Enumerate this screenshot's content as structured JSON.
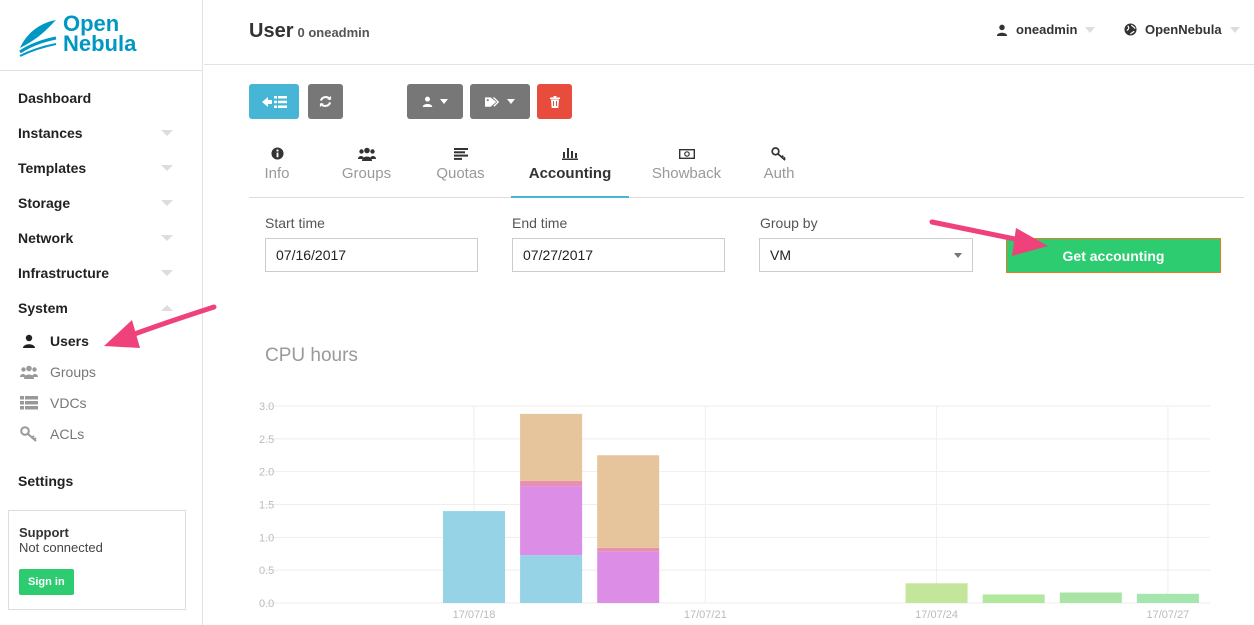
{
  "brand": {
    "logo_line1": "Open",
    "logo_line2": "Nebula"
  },
  "sidebar": {
    "items": [
      {
        "label": "Dashboard",
        "chevron": "none"
      },
      {
        "label": "Instances",
        "chevron": "down"
      },
      {
        "label": "Templates",
        "chevron": "down"
      },
      {
        "label": "Storage",
        "chevron": "down"
      },
      {
        "label": "Network",
        "chevron": "down"
      },
      {
        "label": "Infrastructure",
        "chevron": "down"
      },
      {
        "label": "System",
        "chevron": "up"
      }
    ],
    "system_items": [
      {
        "label": "Users",
        "icon": "user-icon",
        "active": true
      },
      {
        "label": "Groups",
        "icon": "groups-icon",
        "active": false
      },
      {
        "label": "VDCs",
        "icon": "vdcs-icon",
        "active": false
      },
      {
        "label": "ACLs",
        "icon": "key-icon",
        "active": false
      }
    ],
    "settings_label": "Settings",
    "support": {
      "title": "Support",
      "status": "Not connected",
      "signin_label": "Sign in"
    }
  },
  "header": {
    "title": "User",
    "subtitle": "0 oneadmin",
    "user_menu": "oneadmin",
    "zone_menu": "OpenNebula"
  },
  "toolbar": {
    "colors": {
      "blue": "#47b5d5",
      "grey": "#777777",
      "red": "#e74c3c"
    }
  },
  "tabs": [
    {
      "label": "Info",
      "icon": "info-icon",
      "active": false
    },
    {
      "label": "Groups",
      "icon": "groups-icon",
      "active": false
    },
    {
      "label": "Quotas",
      "icon": "quotas-icon",
      "active": false
    },
    {
      "label": "Accounting",
      "icon": "bar-chart-icon",
      "active": true
    },
    {
      "label": "Showback",
      "icon": "money-icon",
      "active": false
    },
    {
      "label": "Auth",
      "icon": "key-icon",
      "active": false
    }
  ],
  "form": {
    "start_label": "Start time",
    "start_value": "07/16/2017",
    "end_label": "End time",
    "end_value": "07/27/2017",
    "group_label": "Group by",
    "group_value": "VM",
    "submit_label": "Get accounting"
  },
  "chart_data": {
    "type": "bar",
    "title": "CPU hours",
    "ylim": [
      0,
      3.0
    ],
    "yticks": [
      "0.0",
      "0.5",
      "1.0",
      "1.5",
      "2.0",
      "2.5",
      "3.0"
    ],
    "xtick_labels": [
      "17/07/18",
      "17/07/21",
      "17/07/24",
      "17/07/27"
    ],
    "grid": true,
    "bars": [
      {
        "day": "17/07/18",
        "segments": [
          {
            "value": 1.4,
            "color": "#96d3e6"
          }
        ]
      },
      {
        "day": "17/07/19",
        "segments": [
          {
            "value": 0.73,
            "color": "#96d3e6"
          },
          {
            "value": 1.05,
            "color": "#dc8ee6"
          },
          {
            "value": 0.08,
            "color": "#e98fb0"
          },
          {
            "value": 1.02,
            "color": "#e6c59c"
          }
        ]
      },
      {
        "day": "17/07/20",
        "segments": [
          {
            "value": 0.78,
            "color": "#dc8ee6"
          },
          {
            "value": 0.06,
            "color": "#e98fb0"
          },
          {
            "value": 1.41,
            "color": "#e6c59c"
          }
        ]
      },
      {
        "day": "17/07/24",
        "segments": [
          {
            "value": 0.3,
            "color": "#c4e69b"
          }
        ]
      },
      {
        "day": "17/07/25",
        "segments": [
          {
            "value": 0.13,
            "color": "#b0e89e"
          }
        ]
      },
      {
        "day": "17/07/26",
        "segments": [
          {
            "value": 0.16,
            "color": "#a9e4a6"
          }
        ]
      },
      {
        "day": "17/07/27",
        "segments": [
          {
            "value": 0.14,
            "color": "#a4e6ad"
          }
        ]
      }
    ]
  }
}
